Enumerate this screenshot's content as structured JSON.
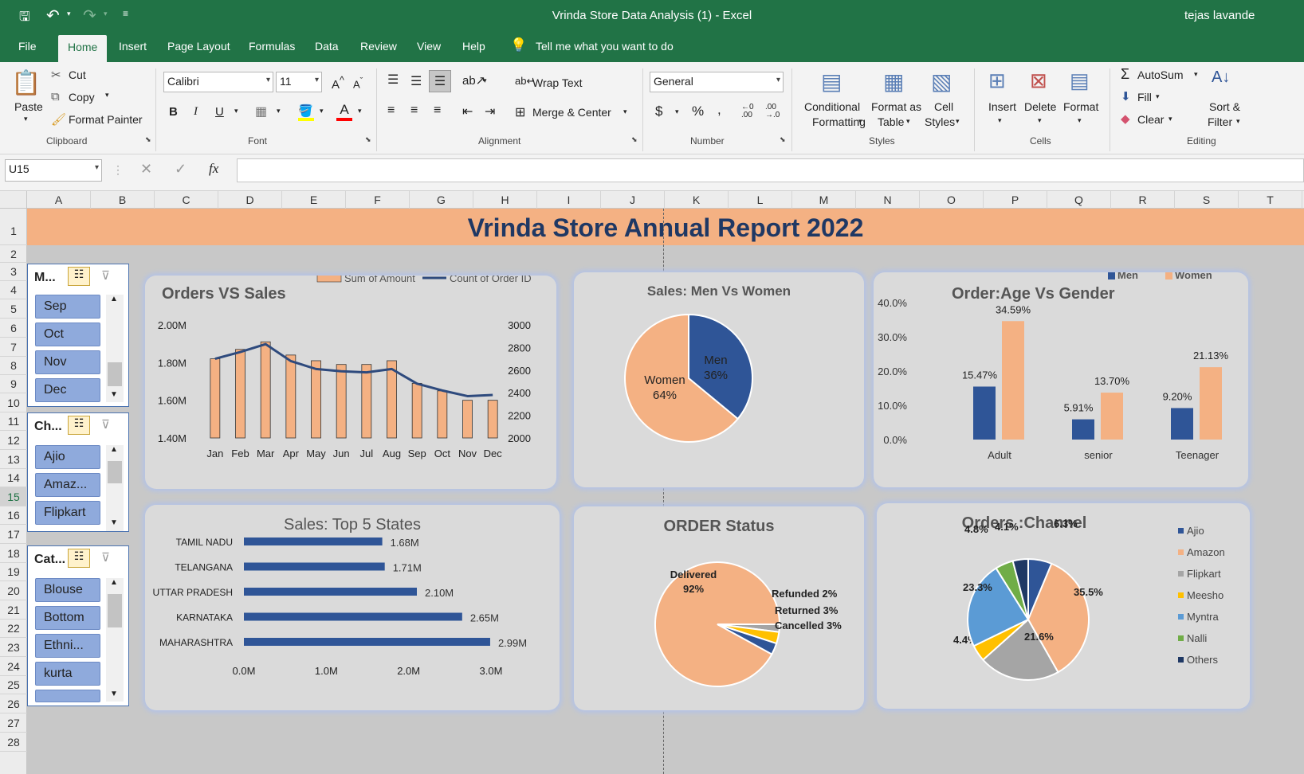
{
  "app": {
    "title": "Vrinda Store Data Analysis (1)  -  Excel",
    "user": "tejas lavande"
  },
  "menu": [
    "File",
    "Home",
    "Insert",
    "Page Layout",
    "Formulas",
    "Data",
    "Review",
    "View",
    "Help"
  ],
  "tell_me": "Tell me what you want to do",
  "ribbon": {
    "clipboard": {
      "paste": "Paste",
      "cut": "Cut",
      "copy": "Copy",
      "format_painter": "Format Painter",
      "group": "Clipboard"
    },
    "font": {
      "name": "Calibri",
      "size": "11",
      "group": "Font"
    },
    "alignment": {
      "wrap": "Wrap Text",
      "merge": "Merge & Center",
      "group": "Alignment"
    },
    "number": {
      "format": "General",
      "group": "Number"
    },
    "styles": {
      "cond1": "Conditional",
      "cond2": "Formatting",
      "table1": "Format as",
      "table2": "Table",
      "cell1": "Cell",
      "cell2": "Styles",
      "group": "Styles"
    },
    "cells": {
      "insert": "Insert",
      "delete": "Delete",
      "format": "Format",
      "group": "Cells"
    },
    "editing": {
      "autosum": "AutoSum",
      "fill": "Fill",
      "clear": "Clear",
      "sort1": "Sort &",
      "sort2": "Filter",
      "group": "Editing"
    }
  },
  "formula_bar": {
    "name_box": "U15",
    "fx": "fx",
    "value": ""
  },
  "columns": [
    "A",
    "B",
    "C",
    "D",
    "E",
    "F",
    "G",
    "H",
    "I",
    "J",
    "K",
    "L",
    "M",
    "N",
    "O",
    "P",
    "Q",
    "R",
    "S",
    "T"
  ],
  "rows": [
    "1",
    "2",
    "3",
    "4",
    "5",
    "6",
    "7",
    "8",
    "9",
    "10",
    "11",
    "12",
    "13",
    "14",
    "15",
    "16",
    "17",
    "18",
    "19",
    "20",
    "21",
    "22",
    "23",
    "24",
    "25",
    "26",
    "27",
    "28"
  ],
  "banner": "Vrinda Store Annual Report 2022",
  "slicers": [
    {
      "header": "M...",
      "items": [
        "Sep",
        "Oct",
        "Nov",
        "Dec"
      ]
    },
    {
      "header": "Ch...",
      "items": [
        "Ajio",
        "Amaz...",
        "Flipkart"
      ]
    },
    {
      "header": "Cat...",
      "items": [
        "Blouse",
        "Bottom",
        "Ethni...",
        "kurta"
      ]
    }
  ],
  "chart_data": [
    {
      "type": "bar",
      "title": "Orders VS Sales",
      "categories": [
        "Jan",
        "Feb",
        "Mar",
        "Apr",
        "May",
        "Jun",
        "Jul",
        "Aug",
        "Sep",
        "Oct",
        "Nov",
        "Dec"
      ],
      "series": [
        {
          "name": "Sum of Amount",
          "axis": "left",
          "type": "bar",
          "color": "#f4b183",
          "values": [
            1.82,
            1.87,
            1.91,
            1.84,
            1.81,
            1.79,
            1.79,
            1.81,
            1.69,
            1.65,
            1.6,
            1.6
          ]
        },
        {
          "name": "Count of Order ID",
          "axis": "right",
          "type": "line",
          "color": "#2e4a7d",
          "values": [
            2700,
            2760,
            2830,
            2680,
            2610,
            2590,
            2580,
            2610,
            2480,
            2420,
            2370,
            2380
          ]
        }
      ],
      "yticks_left": [
        "2.00M",
        "1.80M",
        "1.60M",
        "1.40M"
      ],
      "ylim_left": [
        1.4,
        2.0
      ],
      "yticks_right": [
        "3000",
        "2800",
        "2600",
        "2400",
        "2200",
        "2000"
      ],
      "ylim_right": [
        2000,
        3000
      ]
    },
    {
      "type": "pie",
      "title": "Sales: Men Vs Women",
      "slices": [
        {
          "label": "Men",
          "value": 36,
          "text": "36%",
          "color": "#2f5597"
        },
        {
          "label": "Women",
          "value": 64,
          "text": "64%",
          "color": "#f4b183"
        }
      ]
    },
    {
      "type": "bar",
      "title": "Order:Age Vs Gender",
      "categories": [
        "Adult",
        "senior",
        "Teenager"
      ],
      "series": [
        {
          "name": "Men",
          "color": "#2f5597",
          "values": [
            15.47,
            5.91,
            9.2
          ],
          "labels": [
            "15.47%",
            "5.91%",
            "9.20%"
          ]
        },
        {
          "name": "Women",
          "color": "#f4b183",
          "values": [
            34.59,
            13.7,
            21.13
          ],
          "labels": [
            "34.59%",
            "13.70%",
            "21.13%"
          ]
        }
      ],
      "yticks": [
        "40.0%",
        "30.0%",
        "20.0%",
        "10.0%",
        "0.0%"
      ],
      "ylim": [
        0,
        40
      ]
    },
    {
      "type": "bar",
      "orientation": "horizontal",
      "title": "Sales: Top 5 States",
      "categories": [
        "TAMIL NADU",
        "TELANGANA",
        "UTTAR PRADESH",
        "KARNATAKA",
        "MAHARASHTRA"
      ],
      "values": [
        1.68,
        1.71,
        2.1,
        2.65,
        2.99
      ],
      "labels": [
        "1.68M",
        "1.71M",
        "2.10M",
        "2.65M",
        "2.99M"
      ],
      "xticks": [
        "0.0M",
        "1.0M",
        "2.0M",
        "3.0M"
      ],
      "xlim": [
        0,
        3
      ],
      "color": "#2f5597"
    },
    {
      "type": "pie",
      "title": "ORDER Status",
      "slices": [
        {
          "label": "Delivered",
          "value": 92,
          "text": "92%",
          "color": "#f4b183"
        },
        {
          "label": "Refunded",
          "value": 2,
          "text": "2%",
          "color": "#a5a5a5"
        },
        {
          "label": "Returned",
          "value": 3,
          "text": "3%",
          "color": "#ffc000"
        },
        {
          "label": "Cancelled",
          "value": 3,
          "text": "3%",
          "color": "#2f5597"
        }
      ]
    },
    {
      "type": "pie",
      "title": "Orders :Channel",
      "slices": [
        {
          "label": "Ajio",
          "value": 6.3,
          "text": "6.3%",
          "color": "#2f5597"
        },
        {
          "label": "Amazon",
          "value": 35.5,
          "text": "35.5%",
          "color": "#f4b183"
        },
        {
          "label": "Flipkart",
          "value": 21.6,
          "text": "21.6%",
          "color": "#a5a5a5"
        },
        {
          "label": "Meesho",
          "value": 4.4,
          "text": "4.4%",
          "color": "#ffc000"
        },
        {
          "label": "Myntra",
          "value": 23.3,
          "text": "23.3%",
          "color": "#5b9bd5"
        },
        {
          "label": "Nalli",
          "value": 4.8,
          "text": "4.8%",
          "color": "#70ad47"
        },
        {
          "label": "Others",
          "value": 4.1,
          "text": "4.1%",
          "color": "#1f3864"
        }
      ]
    }
  ]
}
